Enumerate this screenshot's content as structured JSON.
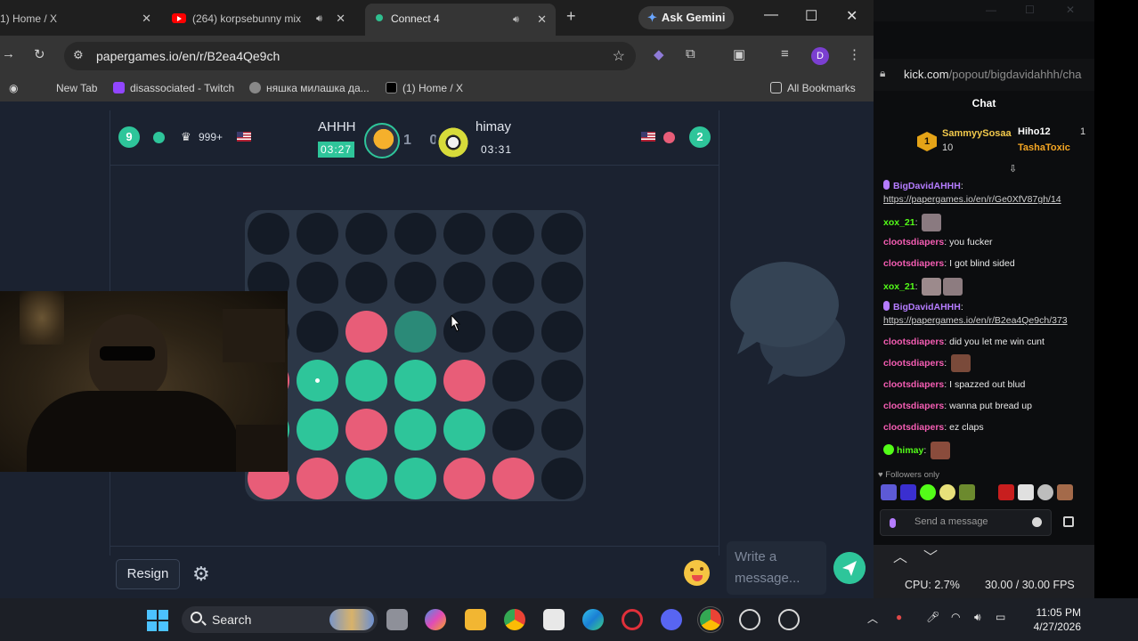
{
  "browser": {
    "tabs": [
      {
        "label": "1) Home / X"
      },
      {
        "label": "(264) korpsebunny mix"
      },
      {
        "label": "Connect 4"
      }
    ],
    "ask_gemini": "Ask Gemini",
    "url": "papergames.io/en/r/B2ea4Qe9ch",
    "profile_initial": "D",
    "bookmarks": [
      {
        "label": "New Tab"
      },
      {
        "label": "disassociated - Twitch"
      },
      {
        "label": "няшка милашка да..."
      },
      {
        "label": "(1) Home / X"
      }
    ],
    "all_bookmarks": "All Bookmarks"
  },
  "game": {
    "left_player": {
      "wins": "9",
      "rank": "999+",
      "name": "AHHH",
      "timer": "03:27"
    },
    "score": "1 0",
    "right_player": {
      "name": "himay",
      "timer": "03:31",
      "wins": "2"
    },
    "board": [
      [
        "e",
        "e",
        "e",
        "e",
        "e",
        "e",
        "e"
      ],
      [
        "e",
        "e",
        "e",
        "e",
        "e",
        "e",
        "e"
      ],
      [
        "e",
        "e",
        "r",
        "h",
        "e",
        "e",
        "e"
      ],
      [
        "r",
        "g",
        "g",
        "g",
        "r",
        "e",
        "e"
      ],
      [
        "g",
        "g",
        "r",
        "g",
        "g",
        "e",
        "e"
      ],
      [
        "r",
        "r",
        "g",
        "g",
        "r",
        "r",
        "e"
      ]
    ],
    "last_move_marker": {
      "row": 3,
      "col": 1
    },
    "resign_label": "Resign",
    "chat_placeholder": "Write a message...",
    "colors": {
      "red": "#e85d78",
      "green": "#2ec59a",
      "empty": "#141b26",
      "board": "#2c3747"
    }
  },
  "kick": {
    "url_host": "kick.com",
    "url_path": "/popout/bigdavidahhh/cha",
    "chat_title": "Chat",
    "pinned": {
      "user1": "SammyySosaa",
      "user1_count": "10",
      "user2": "Hiho12",
      "user2_count": "1",
      "user3": "TashaToxic"
    },
    "messages": [
      {
        "user": "BigDavidAHHH",
        "text": ": "
      },
      {
        "text": "https://papergames.io/en/r/Ge0XfV87gh/14"
      },
      {
        "user": "xox_21",
        "text": ": "
      },
      {
        "user": "clootsdiapers",
        "text": ": you fucker"
      },
      {
        "user": "clootsdiapers",
        "text": ": I got blind sided"
      },
      {
        "user": "xox_21",
        "text": ": "
      },
      {
        "user": "BigDavidAHHH",
        "text": ": "
      },
      {
        "text": "https://papergames.io/en/r/B2ea4Qe9ch/373"
      },
      {
        "user": "clootsdiapers",
        "text": ": did you let me win cunt"
      },
      {
        "user": "clootsdiapers",
        "text": ": "
      },
      {
        "user": "clootsdiapers",
        "text": ": I spazzed out blud"
      },
      {
        "user": "clootsdiapers",
        "text": ": wanna put bread up"
      },
      {
        "user": "clootsdiapers",
        "text": ": ez claps"
      },
      {
        "user": "himay",
        "text": ": "
      }
    ],
    "followers_only": "Followers only",
    "send_placeholder": "Send a message",
    "cpu": "CPU: 2.7%",
    "fps": "30.00 / 30.00 FPS"
  },
  "taskbar": {
    "search_label": "Search",
    "time": "11:05 PM",
    "date": "4/27/2026"
  }
}
